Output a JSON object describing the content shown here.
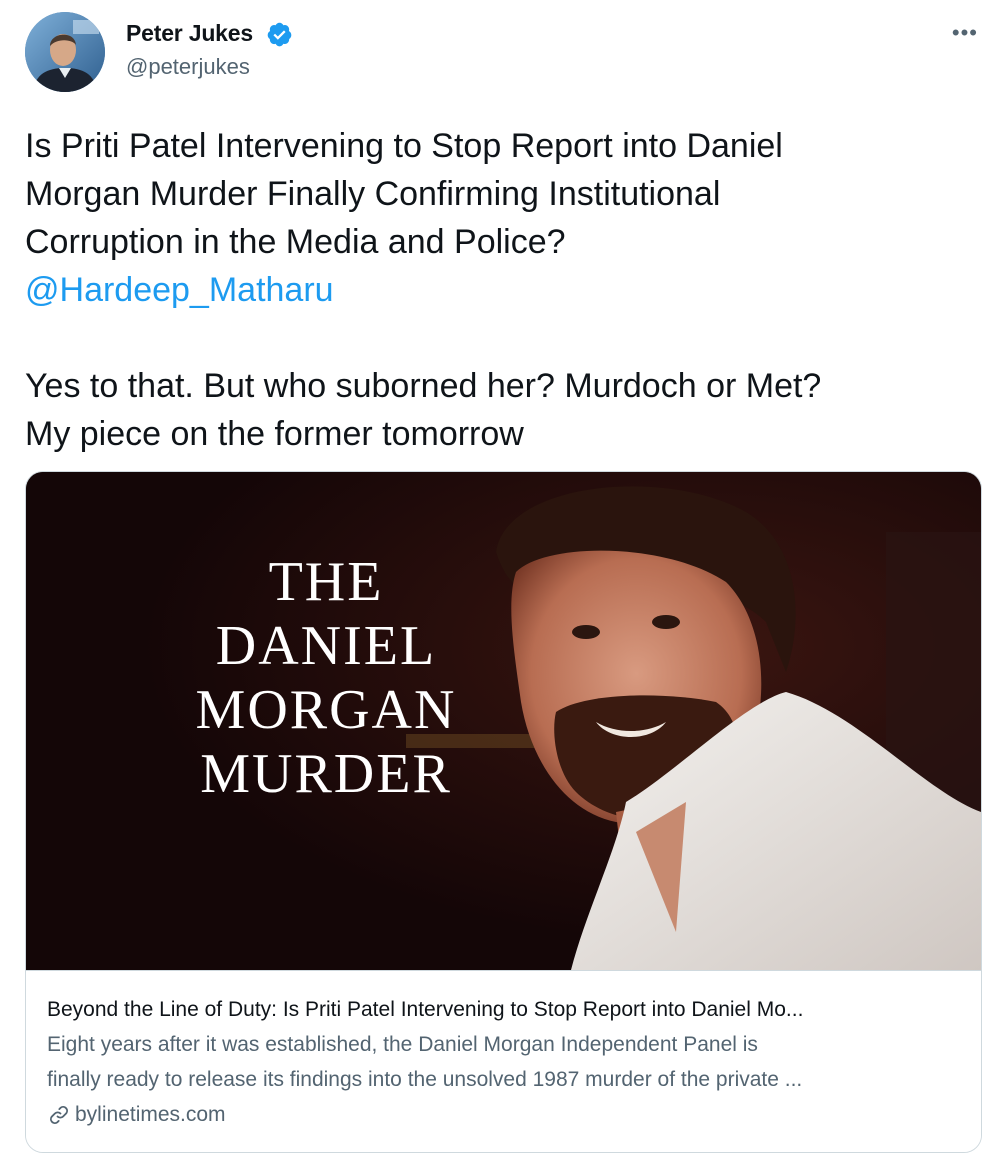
{
  "author": {
    "display_name": "Peter Jukes",
    "handle": "@peterjukes",
    "verified": true
  },
  "tweet": {
    "line1": "Is Priti Patel Intervening to Stop Report into Daniel",
    "line2": "Morgan Murder Finally Confirming Institutional",
    "line3": "Corruption in the Media and Police?",
    "mention": "@Hardeep_Matharu",
    "line5": "Yes to that. But who suborned her? Murdoch or Met?",
    "line6": "My piece on the former tomorrow"
  },
  "card": {
    "image_title": [
      "THE",
      "DANIEL",
      "MORGAN",
      "MURDER"
    ],
    "title": "Beyond the Line of Duty: Is Priti Patel Intervening to Stop Report into Daniel Mo...",
    "description_line1": "Eight years after it was established, the Daniel Morgan Independent Panel is",
    "description_line2": "finally ready to release its findings into the unsolved 1987 murder of the private ...",
    "domain": "bylinetimes.com"
  },
  "icons": {
    "verified": "verified-badge-icon",
    "more": "more-options-icon",
    "link": "link-icon"
  },
  "colors": {
    "accent": "#1d9bf0",
    "secondary_text": "#536471",
    "border": "#cfd9de"
  }
}
